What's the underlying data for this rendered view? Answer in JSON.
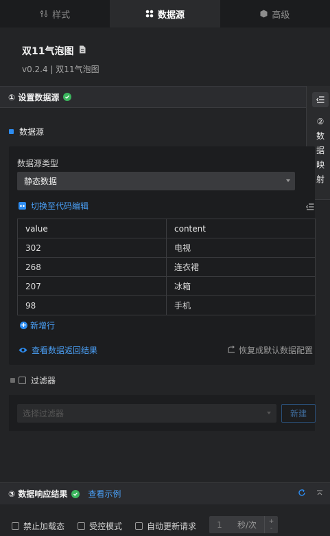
{
  "tabs": [
    {
      "label": "样式",
      "icon": "sliders-icon"
    },
    {
      "label": "数据源",
      "icon": "dots-icon"
    },
    {
      "label": "高级",
      "icon": "cube-icon"
    }
  ],
  "header": {
    "title": "双11气泡图",
    "subtitle": "v0.2.4 | 双11气泡图"
  },
  "section1": {
    "title": "① 设置数据源",
    "status": "ok"
  },
  "mapping": {
    "label_num": "②",
    "label_chars": [
      "数",
      "据",
      "映",
      "射"
    ]
  },
  "datasource": {
    "label": "数据源",
    "type_label": "数据源类型",
    "type_value": "静态数据",
    "code_link": "切换至代码编辑",
    "table": {
      "headers": [
        "value",
        "content"
      ],
      "rows": [
        [
          "302",
          "电视"
        ],
        [
          "268",
          "连衣裙"
        ],
        [
          "207",
          "冰箱"
        ],
        [
          "98",
          "手机"
        ]
      ]
    },
    "add_row": "新增行",
    "view_result": "查看数据返回结果",
    "restore": "恢复成默认数据配置"
  },
  "filter": {
    "label": "过滤器",
    "select_placeholder": "选择过滤器",
    "new_button": "新建"
  },
  "response": {
    "title": "③ 数据响应结果",
    "example_link": "查看示例"
  },
  "footer": {
    "disable_loading": "禁止加载态",
    "controlled_mode": "受控模式",
    "auto_update": "自动更新请求",
    "interval_value": "1",
    "interval_unit": "秒/次"
  },
  "colors": {
    "accent": "#2d8cf0",
    "success": "#3bb55d",
    "background": "#232426"
  }
}
